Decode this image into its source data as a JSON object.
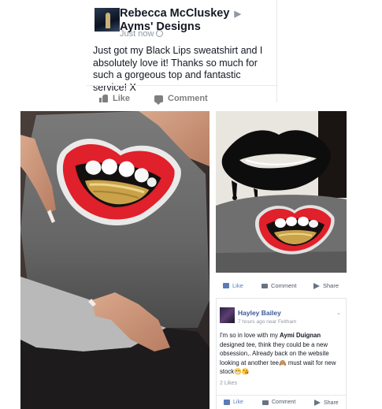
{
  "post": {
    "author": "Rebecca McCluskey",
    "target": "Ayms' Designs",
    "time": "Just now",
    "text": "Just got my Black Lips sweatshirt and I absolutely love it! Thanks so much for such a gorgeous top and fantastic service! X",
    "like_label": "Like",
    "comment_label": "Comment"
  },
  "mini_actions": {
    "like_label": "Like",
    "comment_label": "Comment",
    "share_label": "Share"
  },
  "comment": {
    "author": "Hayley Bailey",
    "meta": "7 hours ago near Feltham",
    "text_before": "I'm so in love with my ",
    "mention": "Aymi Duignan",
    "text_after": " designed tee, think they could be a new obsession,. Already back on the website looking at another tee🙈 must wait for new stock😁😘",
    "likes": "2 Likes",
    "like_label": "Like",
    "comment_label": "Comment",
    "share_label": "Share"
  },
  "colors": {
    "facebook_blue": "#3b5998",
    "lips_red": "#e0202a",
    "shirt_grey": "#707070"
  }
}
